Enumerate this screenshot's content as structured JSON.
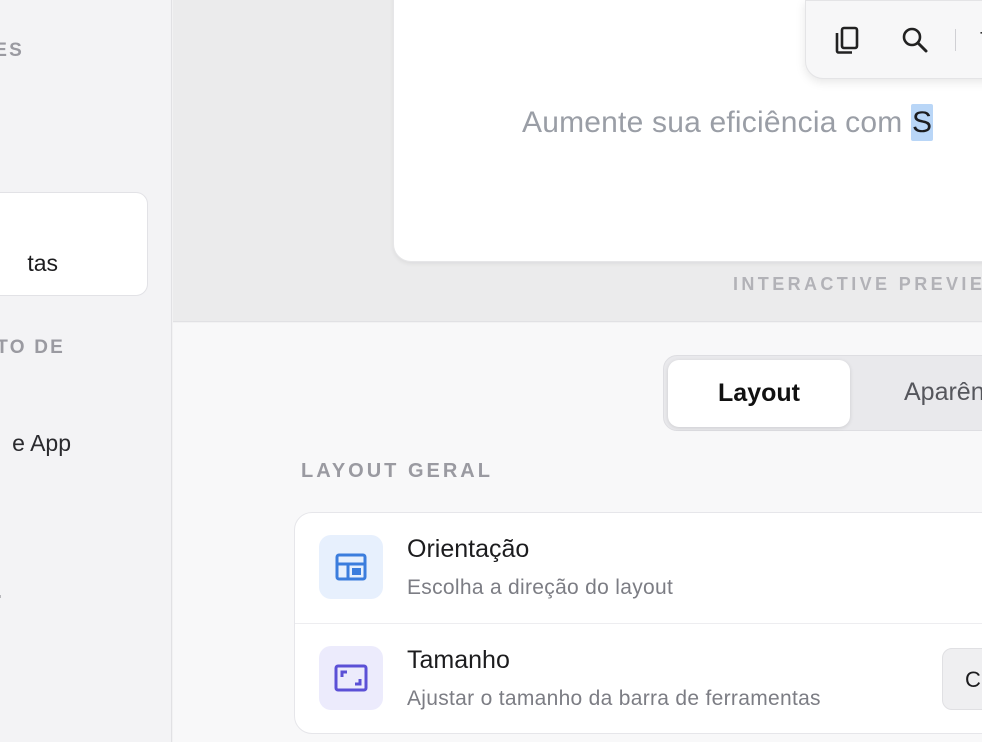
{
  "sidebar": {
    "section1": "ES",
    "selected_item": "tas",
    "section2": "TO DE",
    "item": "e App"
  },
  "preview": {
    "toolbar": {
      "copy_icon": "copy-icon",
      "search_icon": "search-icon",
      "more_glyph": "T"
    },
    "text_before": "Aumente sua eficiência com ",
    "text_highlight": "S",
    "caption": "INTERACTIVE PREVIE"
  },
  "settings": {
    "tabs": [
      {
        "label": "Layout",
        "active": true
      },
      {
        "label": "Aparên",
        "active": false
      }
    ],
    "group_title": "LAYOUT GERAL",
    "rows": [
      {
        "title": "Orientação",
        "subtitle": "Escolha a direção do layout",
        "icon": "layout-icon",
        "icon_color": "#3b7ddd"
      },
      {
        "title": "Tamanho",
        "subtitle": "Ajustar o tamanho da barra de ferramentas",
        "icon": "resize-icon",
        "icon_color": "#5b50d6",
        "control": "C"
      }
    ]
  }
}
